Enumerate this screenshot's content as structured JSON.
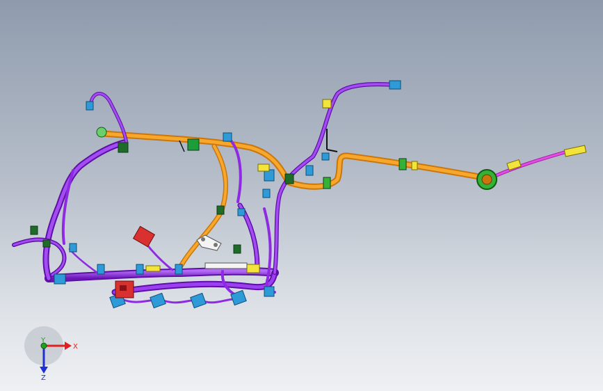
{
  "viewport": {
    "background_top": "#8f9bad",
    "background_bottom": "#eef0f3"
  },
  "model": {
    "kind": "wiring-harness-3d",
    "colors": {
      "purple_wire": "#8e2be2",
      "orange_wire": "#f09a1a",
      "magenta_wire": "#d62fd6",
      "blue_connector": "#2e9ad8",
      "yellow_connector": "#f2e43a",
      "red_connector": "#d93030",
      "green_grommet": "#35b235",
      "white_bracket": "#f4f4f4"
    }
  },
  "triad": {
    "x_label": "X",
    "y_label": "Y",
    "z_label": "Z",
    "x_color": "#e02020",
    "y_color": "#20a020",
    "z_color": "#2030d0"
  }
}
